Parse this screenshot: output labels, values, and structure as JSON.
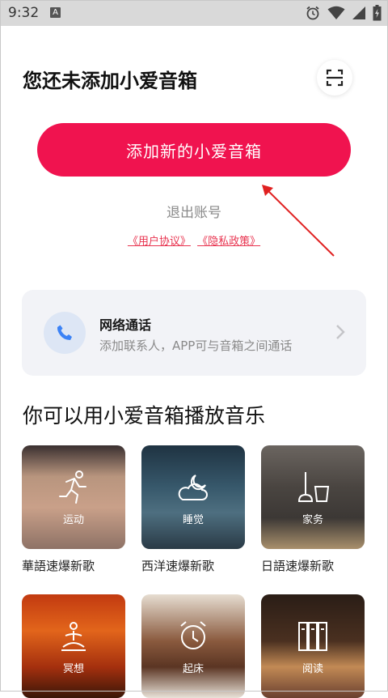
{
  "status_bar": {
    "time": "9:32",
    "notification_badge": "A"
  },
  "header": {
    "title": "您还未添加小爱音箱"
  },
  "add_button": {
    "label": "添加新的小爱音箱"
  },
  "logout": {
    "label": "退出账号"
  },
  "agreements": {
    "user_agreement": "《用户协议》",
    "privacy_policy": "《隐私政策》"
  },
  "call_card": {
    "title": "网络通话",
    "subtitle": "添加联系人，APP可与音箱之间通话"
  },
  "music_section": {
    "title": "你可以用小爱音箱播放音乐",
    "tiles": [
      {
        "overlay": "运动",
        "caption": "華語速爆新歌"
      },
      {
        "overlay": "睡觉",
        "caption": "西洋速爆新歌"
      },
      {
        "overlay": "家务",
        "caption": "日語速爆新歌"
      },
      {
        "overlay": "冥想",
        "caption": ""
      },
      {
        "overlay": "起床",
        "caption": ""
      },
      {
        "overlay": "阅读",
        "caption": ""
      }
    ]
  },
  "colors": {
    "accent": "#f0134f",
    "card_bg": "#f2f3f7",
    "call_icon": "#3b82f6",
    "annotation_arrow": "#e02020"
  },
  "icons": [
    "battery-icon",
    "wifi-icon",
    "signal-icon",
    "alarm-icon",
    "scan-icon",
    "phone-icon",
    "chevron-right-icon"
  ]
}
